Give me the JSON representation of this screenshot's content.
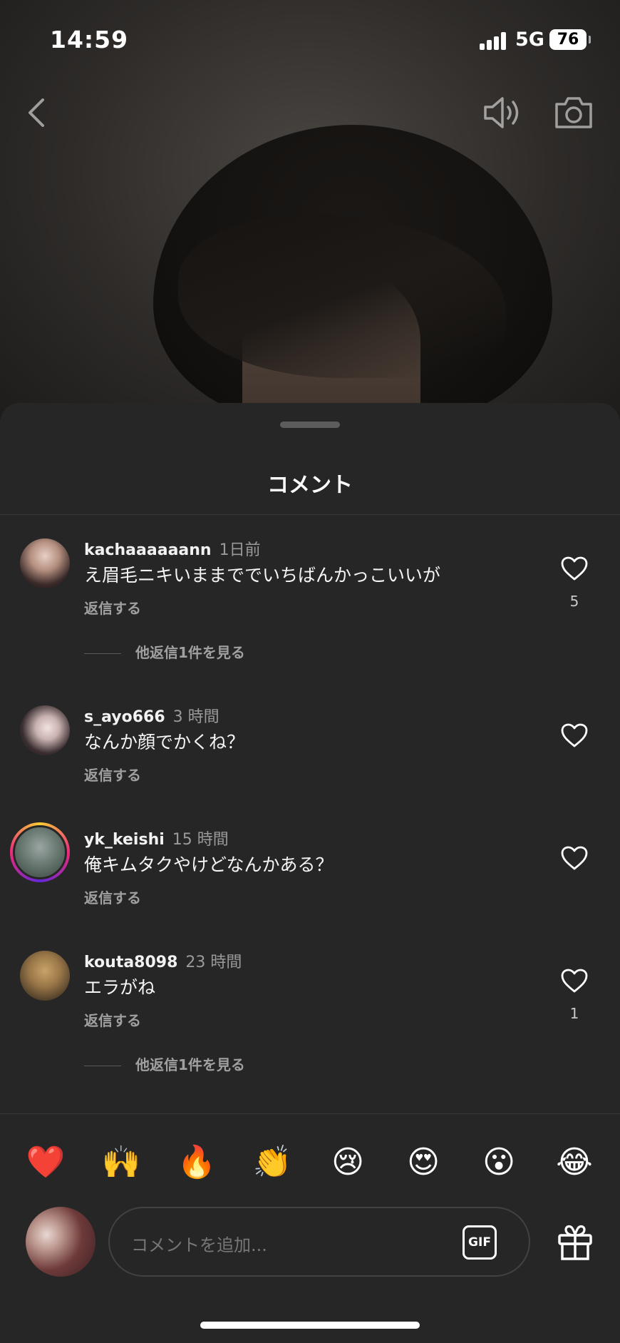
{
  "status_bar": {
    "time": "14:59",
    "network": "5G",
    "battery": "76"
  },
  "top_controls": {
    "back_icon": "chevron-left-icon",
    "sound_icon": "speaker-icon",
    "camera_icon": "camera-icon"
  },
  "sheet": {
    "title": "コメント"
  },
  "comments": [
    {
      "username": "kachaaaaaann",
      "time": "1日前",
      "text": "え眉毛ニキいままででいちばんかっこいいが",
      "reply_label": "返信する",
      "likes": "5",
      "more_replies": "他返信1件を見る"
    },
    {
      "username": "s_ayo666",
      "time": "3 時間",
      "text": "なんか顔でかくね？",
      "reply_label": "返信する"
    },
    {
      "username": "yk_keishi",
      "time": "15 時間",
      "text": "俺キムタクやけどなんかある？",
      "reply_label": "返信する"
    },
    {
      "username": "kouta8098",
      "time": "23 時間",
      "text": "エラがね",
      "reply_label": "返信する",
      "likes": "1",
      "more_replies": "他返信1件を見る"
    }
  ],
  "emoji_reactions": [
    "❤️",
    "🙌",
    "🔥",
    "👏",
    "😢",
    "😍",
    "😮",
    "😂"
  ],
  "composer": {
    "placeholder": "コメントを追加...",
    "gif_label": "GIF",
    "gift_icon": "gift-icon"
  },
  "colors": {
    "background": "#262626",
    "text": "#ffffff",
    "muted": "#a0a0a0",
    "ring_gradient": [
      "#f9ce34",
      "#ee2a7b",
      "#6228d7"
    ]
  }
}
